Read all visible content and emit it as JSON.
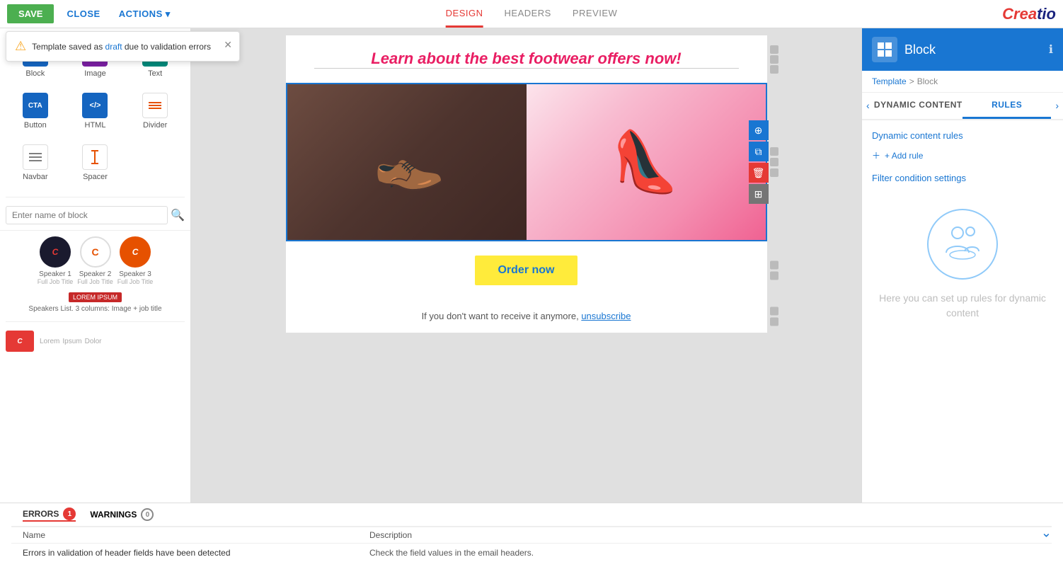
{
  "toolbar": {
    "save_label": "SAVE",
    "close_label": "CLOSE",
    "actions_label": "ACTIONS",
    "tabs": [
      {
        "id": "design",
        "label": "DESIGN",
        "active": true
      },
      {
        "id": "headers",
        "label": "HEADERS",
        "active": false
      },
      {
        "id": "preview",
        "label": "PREVIEW",
        "active": false
      }
    ],
    "logo": "Creatio"
  },
  "notification": {
    "text": "Template saved as draft due to validation errors",
    "link_text": "draft",
    "icon": "⚠"
  },
  "sidebar": {
    "search_placeholder": "Enter name of block",
    "items": [
      {
        "id": "block",
        "label": "Block",
        "icon": "▦"
      },
      {
        "id": "image",
        "label": "Image",
        "icon": "🖼"
      },
      {
        "id": "text",
        "label": "Text",
        "icon": "T"
      },
      {
        "id": "button",
        "label": "Button",
        "icon": "CTA"
      },
      {
        "id": "html",
        "label": "HTML",
        "icon": "<>"
      },
      {
        "id": "divider",
        "label": "Divider",
        "icon": "≡"
      },
      {
        "id": "navbar",
        "label": "Navbar",
        "icon": "☰"
      },
      {
        "id": "spacer",
        "label": "Spacer",
        "icon": "↕"
      }
    ],
    "speaker_block": {
      "label": "Speakers List. 3 columns: Image + job title",
      "speakers": [
        {
          "name": "Speaker 1",
          "sub": "Full Job Title"
        },
        {
          "name": "Speaker 2",
          "sub": "Full Job Title"
        },
        {
          "name": "Speaker 3",
          "sub": "Full Job Title"
        }
      ]
    }
  },
  "canvas": {
    "headline": "Learn about the best footwear offers now!",
    "cta_button": "Order now",
    "footer_text": "If you don't want to receive it anymore, ",
    "footer_link": "unsubscribe"
  },
  "right_panel": {
    "header": {
      "icon": "▦",
      "title": "Block",
      "info_label": "ℹ"
    },
    "breadcrumb": {
      "parent": "Template",
      "separator": ">",
      "current": "Block"
    },
    "tabs": [
      {
        "id": "dynamic",
        "label": "DYNAMIC CONTENT"
      },
      {
        "id": "rules",
        "label": "RULES",
        "active": true
      }
    ],
    "dynamic_rules_title": "Dynamic content rules",
    "add_rule_label": "+ Add rule",
    "filter_condition_title": "Filter condition settings",
    "placeholder_text": "Here you can set up rules for dynamic content"
  },
  "bottom_bar": {
    "errors_label": "ERRORS",
    "errors_count": "1",
    "warnings_label": "WARNINGS",
    "warnings_count": "0",
    "columns": [
      "Name",
      "Description"
    ],
    "rows": [
      {
        "name": "Errors in validation of header fields have been detected",
        "description": "Check the field values in the email headers."
      }
    ]
  }
}
